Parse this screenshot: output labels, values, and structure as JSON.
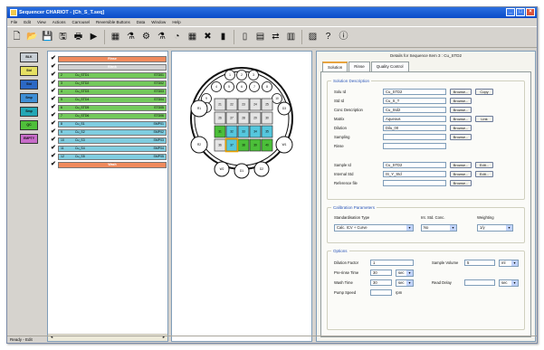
{
  "window": {
    "title": "Sequencer CHARIOT - [Ch_S_T.seq]"
  },
  "menu": [
    "File",
    "Edit",
    "View",
    "Actions",
    "Carrousel",
    "Reversible Buttons",
    "Data",
    "Window",
    "Help"
  ],
  "toolbar_icons": [
    "new-icon",
    "open-icon",
    "save-icon",
    "save-as-icon",
    "print-icon",
    "run-icon",
    "rack-icon",
    "beakers-icon",
    "settings-icon",
    "flask-icon",
    "calibrate-icon",
    "grid-icon",
    "delete-icon",
    "bottle-icon",
    "tube-icon",
    "table-icon",
    "move-icon",
    "report-icon",
    "chart-icon",
    "help-icon",
    "info-icon"
  ],
  "tool_strip": [
    {
      "label": "BLK",
      "color": "#c9d0d6"
    },
    {
      "label": "Std",
      "color": "#e6e062"
    },
    {
      "label": "Std",
      "color": "#2c68c4"
    },
    {
      "label": "Smp",
      "color": "#3f8fd6"
    },
    {
      "label": "Smp",
      "color": "#23a7b5"
    },
    {
      "label": "QC",
      "color": "#4fbf3a"
    },
    {
      "label": "EMPTY",
      "color": "#c86cc9"
    }
  ],
  "sequence": [
    {
      "check": "✔",
      "num": "",
      "name": "Rinse",
      "code": "",
      "color": "#f08a5c",
      "centered": true
    },
    {
      "check": "✔",
      "num": "1",
      "name": "Blank",
      "code": "LQ-01",
      "color": "#d2d2d2",
      "centered": true
    },
    {
      "check": "✔",
      "num": "2",
      "name": "Cu_STD1",
      "code": "STD01",
      "color": "#73c95b"
    },
    {
      "check": "✔",
      "num": "3",
      "name": "Cu_STD2",
      "code": "STD02",
      "color": "#73c95b"
    },
    {
      "check": "✔",
      "num": "4",
      "name": "Cu_STD3",
      "code": "STD03",
      "color": "#73c95b"
    },
    {
      "check": "✔",
      "num": "5",
      "name": "Cu_STD4",
      "code": "STD04",
      "color": "#73c95b"
    },
    {
      "check": "✔",
      "num": "6",
      "name": "Cu_STD5",
      "code": "STD05",
      "color": "#73c95b"
    },
    {
      "check": "✔",
      "num": "7",
      "name": "Cu_STD6",
      "code": "STD06",
      "color": "#73c95b"
    },
    {
      "check": "✔",
      "num": "8",
      "name": "Cu_S1",
      "code": "SMP01",
      "color": "#7fcde0"
    },
    {
      "check": "✔",
      "num": "9",
      "name": "Cu_S2",
      "code": "SMP02",
      "color": "#7fcde0"
    },
    {
      "check": "✔",
      "num": "10",
      "name": "Cu_S3",
      "code": "SMP03",
      "color": "#7fcde0"
    },
    {
      "check": "✔",
      "num": "11",
      "name": "Cu_S4",
      "code": "SMP04",
      "color": "#7fcde0"
    },
    {
      "check": "✔",
      "num": "12",
      "name": "Cu_S5",
      "code": "SMP05",
      "color": "#7fcde0"
    },
    {
      "check": "✔",
      "num": "",
      "name": "Wash",
      "code": "",
      "color": "#f08a5c",
      "centered": true
    }
  ],
  "carousel": {
    "ring": [
      "1",
      "2",
      "3",
      "4",
      "5",
      "6",
      "7",
      "8",
      "9",
      "10",
      "11"
    ],
    "side_positions": [
      "R1",
      "R2",
      "W1",
      "W2",
      "D1",
      "D2",
      "D3"
    ],
    "grid": [
      [
        "21",
        "22",
        "23",
        "24",
        "25"
      ],
      [
        "26",
        "27",
        "28",
        "29",
        "30"
      ],
      [
        "31",
        "32",
        "33",
        "34",
        "35"
      ],
      [
        "36",
        "37",
        "38",
        "39",
        "40"
      ]
    ]
  },
  "detail": {
    "title": "Details for Sequence Item 3 : Cu_STD2",
    "tabs": [
      "Solution",
      "Rinse",
      "Quality Control"
    ],
    "sample_group": "Solution Description",
    "fields": [
      {
        "label": "Solu Id",
        "value": "Cu_STD2"
      },
      {
        "label": "Std Id",
        "value": "Cu_S_T"
      },
      {
        "label": "Conc Description",
        "value": "Cu_Std2"
      },
      {
        "label": "Matrix",
        "value": "Aqueous"
      },
      {
        "label": "Dilution",
        "value": "Dilu_00"
      },
      {
        "label": "Sampling",
        "value": ""
      },
      {
        "label": "Rinse",
        "value": ""
      }
    ],
    "extra_fields": [
      {
        "label": "Sample Id",
        "value": "Cu_STD2"
      },
      {
        "label": "Internal Std",
        "value": "IS_Y_Std"
      },
      {
        "label": "Reference file",
        "value": ""
      }
    ],
    "browse_label": "Browse...",
    "edit_label": "Edit...",
    "copy_label": "Copy",
    "link_label": "Link",
    "calib_group": "Calibration Parameters",
    "calib_labels": {
      "type": "Standardisation Type",
      "curve": "Int. Std. Conc.",
      "weight": "Weighting"
    },
    "calib_values": {
      "type": "Calc. ICV + Curve",
      "curve": "No",
      "weight": "1/y"
    },
    "options_group": "Options",
    "option_rows": [
      {
        "label": "Dilution Factor",
        "value": "1"
      },
      {
        "label": "Pre-rinse Time",
        "value": "30",
        "unit": "sec"
      },
      {
        "label": "Wash Time",
        "value": "30",
        "unit": "sec"
      },
      {
        "label": "Pump Speed",
        "value": "",
        "unit": "rpm"
      }
    ],
    "right_options": [
      {
        "label": "Sample Volume",
        "value": "5",
        "unit": "ml"
      },
      {
        "label": "Read Delay",
        "value": "",
        "unit": "sec"
      }
    ]
  },
  "status": {
    "text": "Ready - Edit"
  }
}
